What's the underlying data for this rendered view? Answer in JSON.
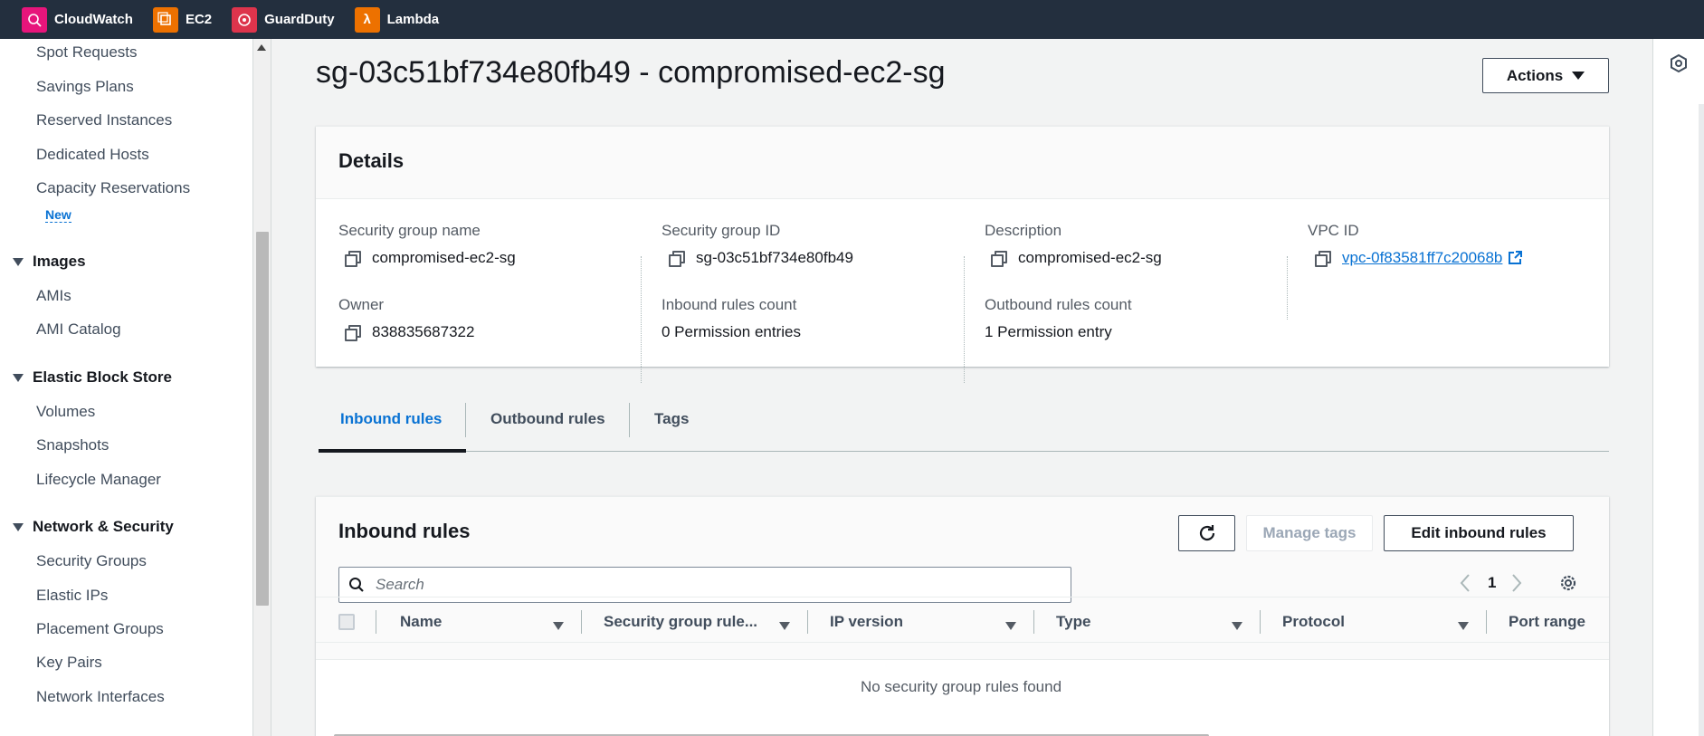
{
  "topbar": {
    "services": [
      {
        "label": "CloudWatch",
        "icon": "cloudwatch-icon",
        "color": "#e7157b"
      },
      {
        "label": "EC2",
        "icon": "ec2-icon",
        "color": "#ed7100"
      },
      {
        "label": "GuardDuty",
        "icon": "guardduty-icon",
        "color": "#dd344c"
      },
      {
        "label": "Lambda",
        "icon": "lambda-icon",
        "color": "#ed7100"
      }
    ]
  },
  "sidebar": {
    "items_top": [
      "Spot Requests",
      "Savings Plans",
      "Reserved Instances",
      "Dedicated Hosts",
      "Capacity Reservations"
    ],
    "new_badge": "New",
    "sections": [
      {
        "title": "Images",
        "items": [
          "AMIs",
          "AMI Catalog"
        ]
      },
      {
        "title": "Elastic Block Store",
        "items": [
          "Volumes",
          "Snapshots",
          "Lifecycle Manager"
        ]
      },
      {
        "title": "Network & Security",
        "items": [
          "Security Groups",
          "Elastic IPs",
          "Placement Groups",
          "Key Pairs",
          "Network Interfaces"
        ]
      }
    ]
  },
  "page": {
    "title": "sg-03c51bf734e80fb49 - compromised-ec2-sg",
    "actions_label": "Actions"
  },
  "details": {
    "title": "Details",
    "fields": {
      "sg_name_label": "Security group name",
      "sg_name": "compromised-ec2-sg",
      "sg_id_label": "Security group ID",
      "sg_id": "sg-03c51bf734e80fb49",
      "description_label": "Description",
      "description": "compromised-ec2-sg",
      "vpc_label": "VPC ID",
      "vpc_id": "vpc-0f83581ff7c20068b",
      "owner_label": "Owner",
      "owner": "838835687322",
      "inbound_count_label": "Inbound rules count",
      "inbound_count": "0 Permission entries",
      "outbound_count_label": "Outbound rules count",
      "outbound_count": "1 Permission entry"
    }
  },
  "tabs": [
    "Inbound rules",
    "Outbound rules",
    "Tags"
  ],
  "inbound": {
    "title": "Inbound rules",
    "manage_tags": "Manage tags",
    "edit_rules": "Edit inbound rules",
    "search_placeholder": "Search",
    "page_number": "1",
    "columns": [
      "Name",
      "Security group rule...",
      "IP version",
      "Type",
      "Protocol",
      "Port range"
    ],
    "empty_message": "No security group rules found"
  }
}
